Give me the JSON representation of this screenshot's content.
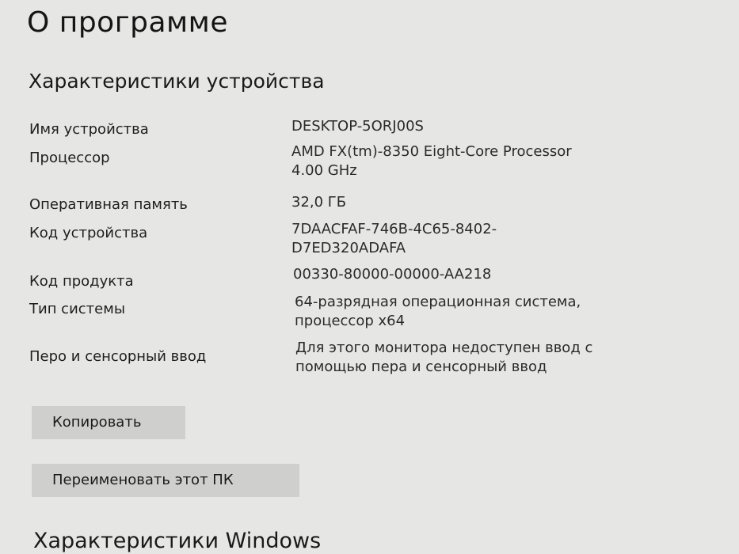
{
  "page": {
    "title": "О программе"
  },
  "device_specs": {
    "heading": "Характеристики устройства",
    "rows": [
      {
        "label": "Имя устройства",
        "value": [
          "DESKTOP-5ORJ00S"
        ]
      },
      {
        "label": "Процессор",
        "value": [
          "AMD FX(tm)-8350 Eight-Core Processor",
          "4.00 GHz"
        ]
      },
      {
        "label": "Оперативная память",
        "value": [
          "32,0 ГБ"
        ]
      },
      {
        "label": "Код устройства",
        "value": [
          "7DAACFAF-746B-4C65-8402-",
          "D7ED320ADAFA"
        ]
      },
      {
        "label": "Код продукта",
        "value": [
          "00330-80000-00000-AA218"
        ]
      },
      {
        "label": "Тип системы",
        "value": [
          "64-разрядная операционная система,",
          "процессор x64"
        ]
      },
      {
        "label": "Перо и сенсорный ввод",
        "value": [
          "Для этого монитора недоступен ввод с",
          "помощью пера и сенсорный ввод"
        ]
      }
    ]
  },
  "buttons": {
    "copy_label": "Копировать",
    "rename_label": "Переименовать этот ПК"
  },
  "windows_specs": {
    "heading": "Характеристики Windows"
  }
}
